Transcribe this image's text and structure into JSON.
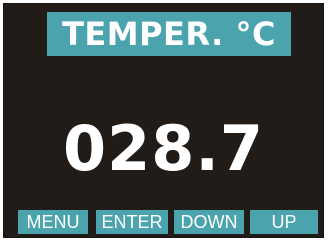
{
  "display": {
    "title": "TEMPER. °C",
    "value": "028.7"
  },
  "softkeys": {
    "menu": "MENU",
    "enter": "ENTER",
    "down": "DOWN",
    "up": "UP"
  },
  "colors": {
    "screen_background": "#221c19",
    "accent": "#4aa3ad",
    "text": "#ffffff"
  }
}
